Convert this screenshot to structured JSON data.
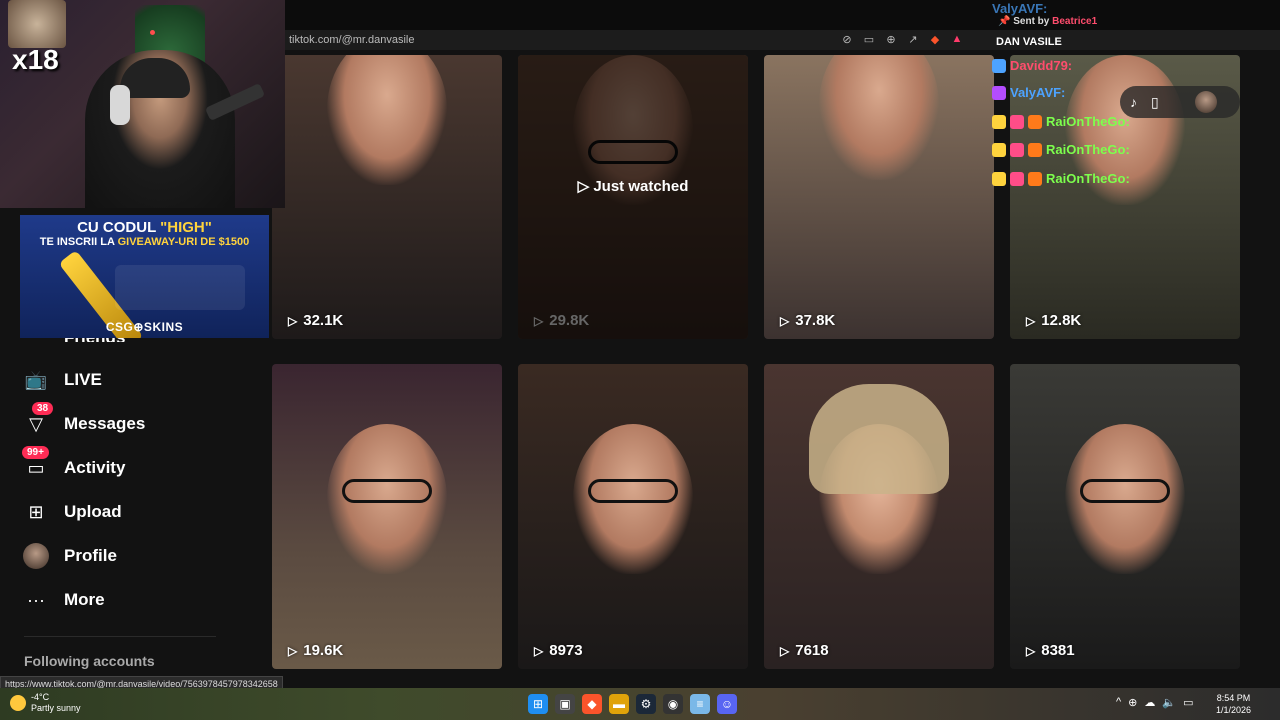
{
  "browser": {
    "url": "tiktok.com/@mr.danvasile"
  },
  "overlay": {
    "multiplier": "x18",
    "sent_by_prefix": "Sent by",
    "sent_by_name": "Beatrice1",
    "streamer_name": "DAN VASILE",
    "chat": [
      {
        "user": "Davidd79:",
        "color": "#ff4d6d"
      },
      {
        "user": "ValyAVF:",
        "color": "#4da3ff"
      },
      {
        "user": "RaiOnTheGo:",
        "color": "#7dff4d"
      },
      {
        "user": "RaiOnTheGo:",
        "color": "#7dff4d"
      },
      {
        "user": "RaiOnTheGo:",
        "color": "#7dff4d"
      }
    ]
  },
  "ad": {
    "line1_a": "CU CODUL ",
    "line1_b": "\"HIGH\"",
    "line2_a": "TE INSCRII LA ",
    "line2_b": "GIVEAWAY-URI DE $1500",
    "brand": "CSG⊕SKINS"
  },
  "sidebar": {
    "friends": "Friends",
    "live": "LIVE",
    "messages": "Messages",
    "messages_badge": "38",
    "activity": "Activity",
    "activity_badge": "99+",
    "upload": "Upload",
    "profile": "Profile",
    "more": "More",
    "following_accounts": "Following accounts"
  },
  "videos": [
    {
      "views": "32.1K",
      "bg": "#3a2a28"
    },
    {
      "views": "29.8K",
      "bg": "#5a3a2c",
      "just_watched": "Just watched"
    },
    {
      "views": "37.8K",
      "bg": "#6b5a4a"
    },
    {
      "views": "12.8K",
      "bg": "#4a4a3a"
    },
    {
      "views": "19.6K",
      "bg": "#3a2530"
    },
    {
      "views": "8973",
      "bg": "#2a2220"
    },
    {
      "views": "7618",
      "bg": "#3a2a2a"
    },
    {
      "views": "8381",
      "bg": "#2a2a28"
    }
  ],
  "status_link": "https://www.tiktok.com/@mr.danvasile/video/7563978457978342658",
  "taskbar": {
    "temp": "-4°C",
    "weather": "Partly sunny",
    "time": "8:54 PM",
    "date": "1/1/2026"
  }
}
